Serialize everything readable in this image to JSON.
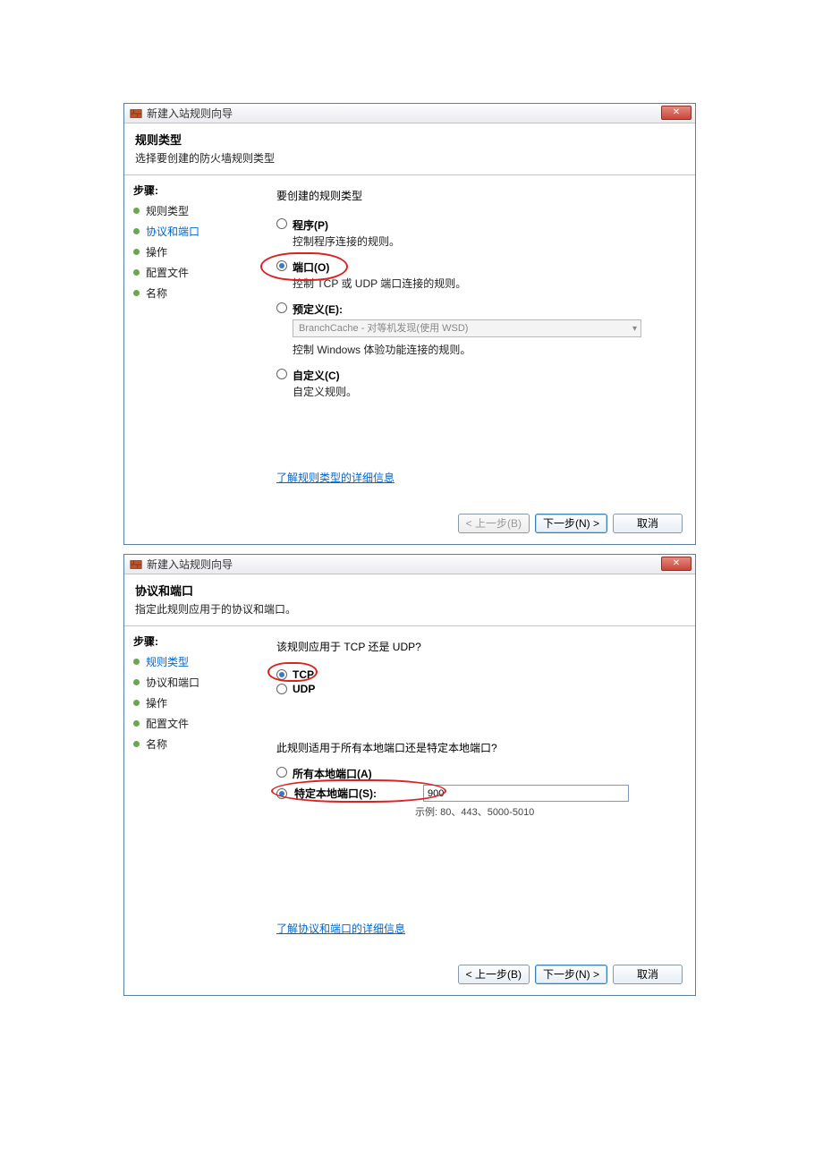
{
  "dialog1": {
    "title": "新建入站规则向导",
    "header_title": "规则类型",
    "header_desc": "选择要创建的防火墙规则类型",
    "steps_label": "步骤:",
    "steps": [
      {
        "label": "规则类型",
        "active": false
      },
      {
        "label": "协议和端口",
        "active": true
      },
      {
        "label": "操作",
        "active": false
      },
      {
        "label": "配置文件",
        "active": false
      },
      {
        "label": "名称",
        "active": false
      }
    ],
    "prompt": "要创建的规则类型",
    "options": {
      "program": {
        "label": "程序(P)",
        "desc": "控制程序连接的规则。"
      },
      "port": {
        "label": "端口(O)",
        "desc": "控制 TCP 或 UDP 端口连接的规则。",
        "selected": true
      },
      "predef": {
        "label": "预定义(E):",
        "desc": "控制 Windows 体验功能连接的规则。"
      },
      "custom": {
        "label": "自定义(C)",
        "desc": "自定义规则。"
      }
    },
    "predef_value": "BranchCache - 对等机发现(使用 WSD)",
    "link": "了解规则类型的详细信息",
    "buttons": {
      "back": "< 上一步(B)",
      "next": "下一步(N) >",
      "cancel": "取消"
    }
  },
  "dialog2": {
    "title": "新建入站规则向导",
    "header_title": "协议和端口",
    "header_desc": "指定此规则应用于的协议和端口。",
    "steps_label": "步骤:",
    "steps": [
      {
        "label": "规则类型",
        "active": true
      },
      {
        "label": "协议和端口",
        "active": false
      },
      {
        "label": "操作",
        "active": false
      },
      {
        "label": "配置文件",
        "active": false
      },
      {
        "label": "名称",
        "active": false
      }
    ],
    "protocol_question": "该规则应用于 TCP 还是 UDP?",
    "tcp_label": "TCP",
    "udp_label": "UDP",
    "port_question": "此规则适用于所有本地端口还是特定本地端口?",
    "all_ports_label": "所有本地端口(A)",
    "specific_ports_label": "特定本地端口(S):",
    "port_value": "900",
    "example": "示例: 80、443、5000-5010",
    "link": "了解协议和端口的详细信息",
    "buttons": {
      "back": "< 上一步(B)",
      "next": "下一步(N) >",
      "cancel": "取消"
    }
  }
}
